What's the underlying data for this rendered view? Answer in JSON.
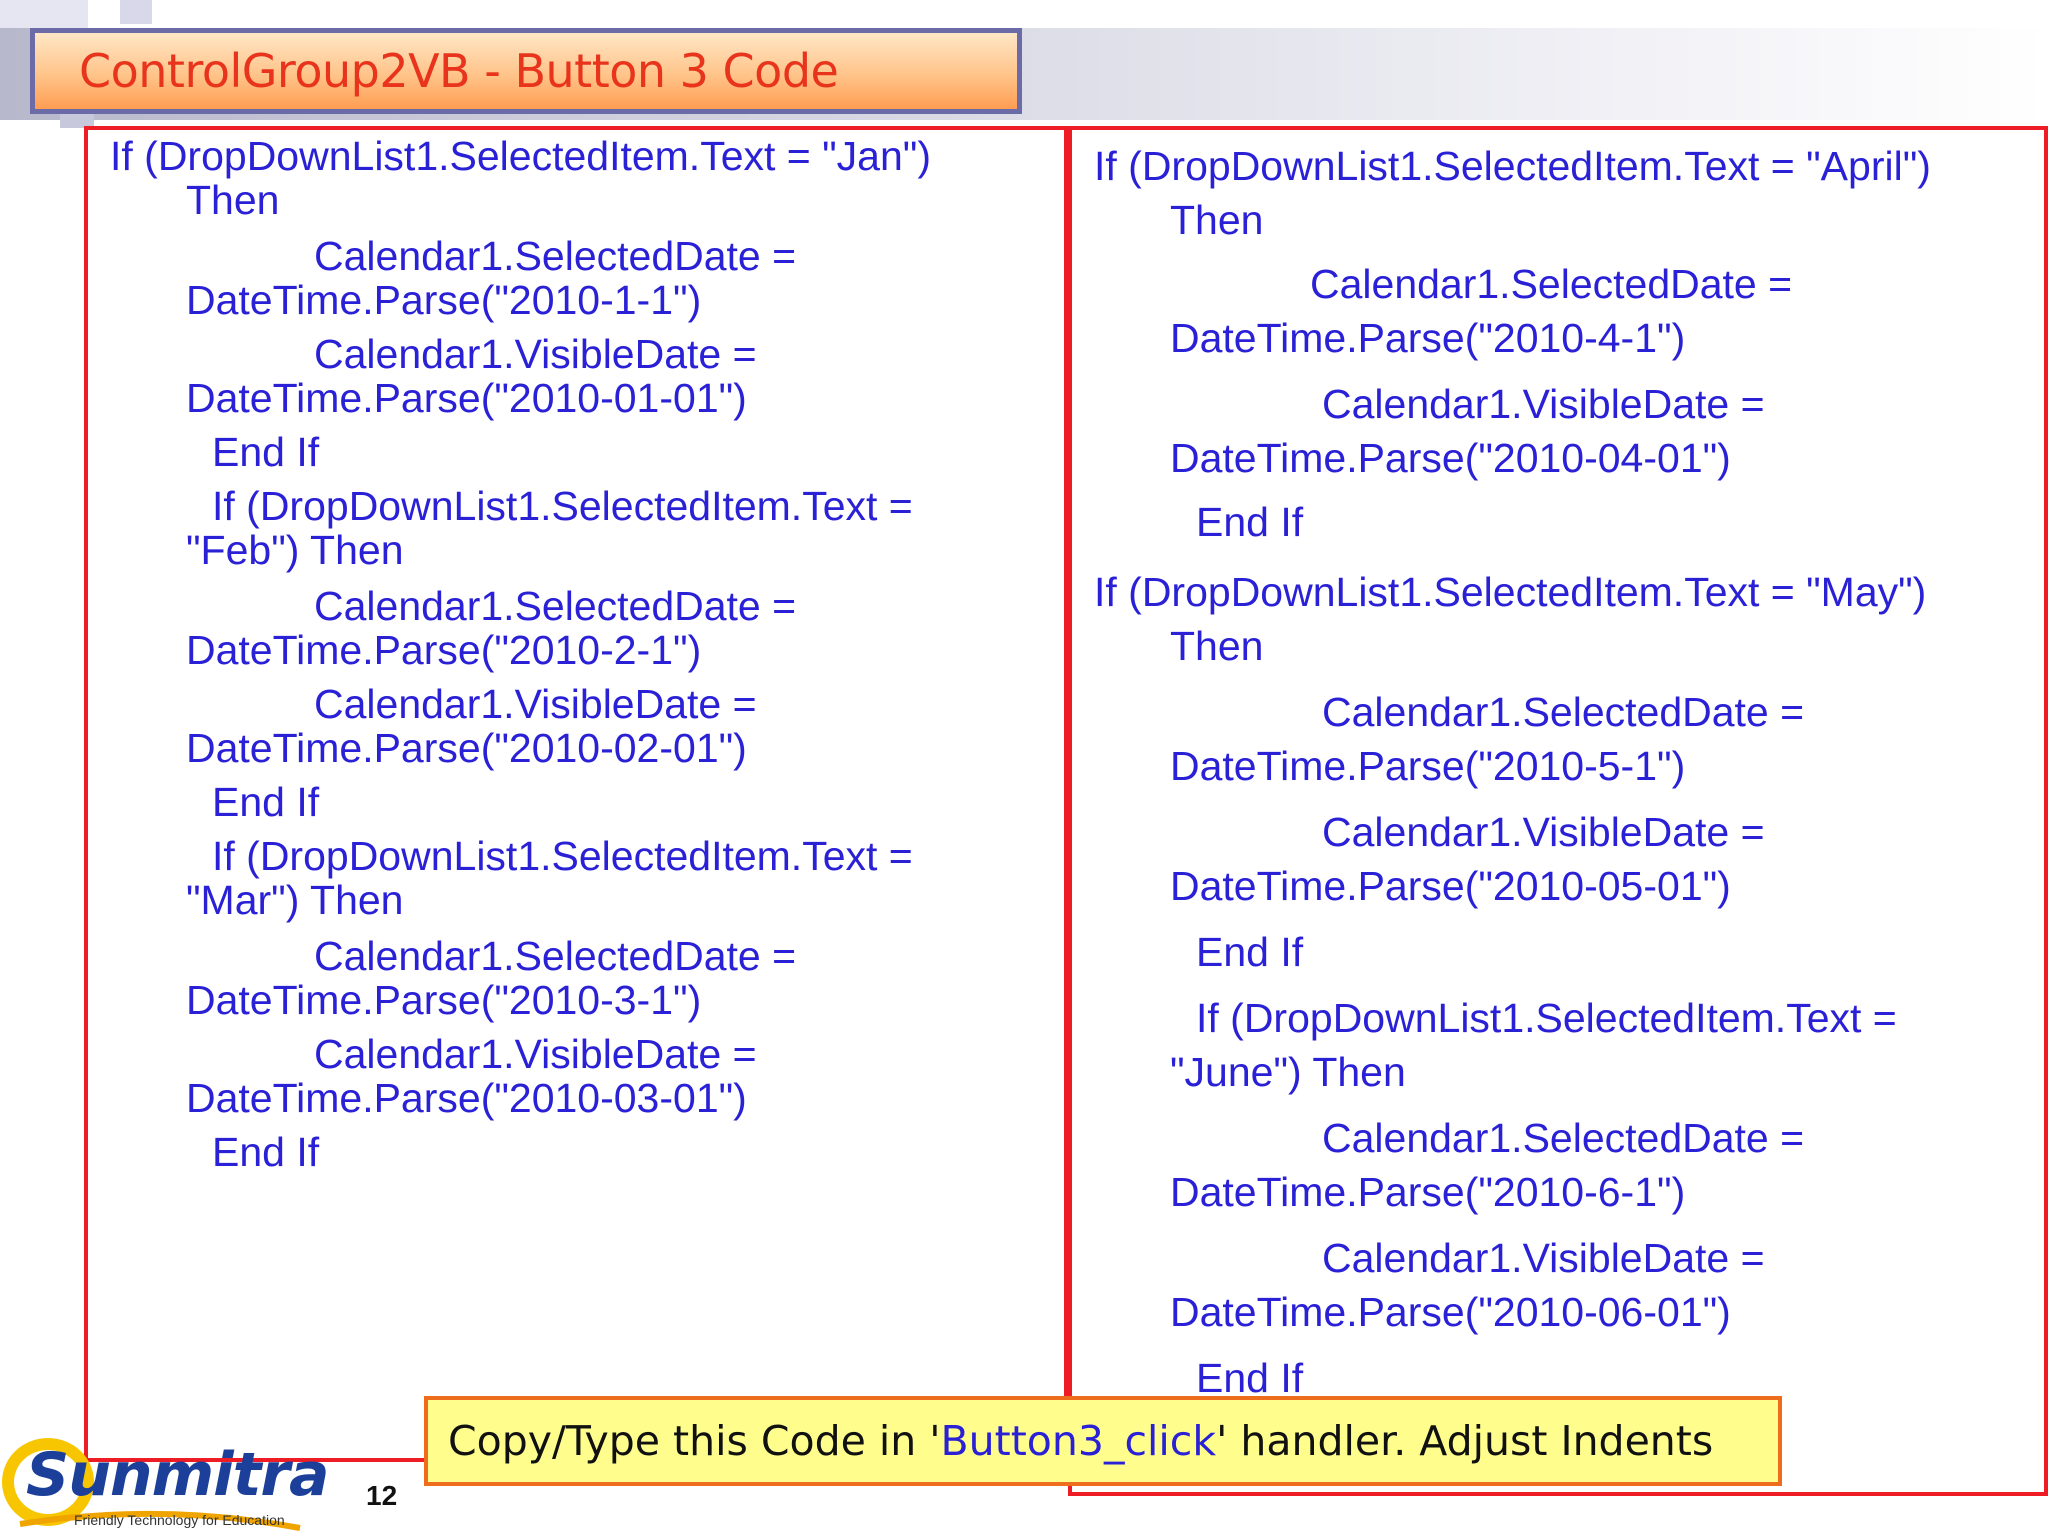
{
  "slide": {
    "title": "ControlGroup2VB - Button 3 Code",
    "page_number": "12"
  },
  "left_code": [
    "If (DropDownList1.SelectedItem.Text = \"Jan\")",
    "Then",
    "Calendar1.SelectedDate =",
    "DateTime.Parse(\"2010-1-1\")",
    "Calendar1.VisibleDate =",
    "DateTime.Parse(\"2010-01-01\")",
    "End If",
    "If (DropDownList1.SelectedItem.Text =",
    "\"Feb\") Then",
    "Calendar1.SelectedDate =",
    "DateTime.Parse(\"2010-2-1\")",
    "Calendar1.VisibleDate =",
    "DateTime.Parse(\"2010-02-01\")",
    "End If",
    "If (DropDownList1.SelectedItem.Text =",
    "\"Mar\") Then",
    "Calendar1.SelectedDate =",
    "DateTime.Parse(\"2010-3-1\")",
    "Calendar1.VisibleDate =",
    "DateTime.Parse(\"2010-03-01\")",
    "End If"
  ],
  "right_code": [
    "If (DropDownList1.SelectedItem.Text = \"April\")",
    "Then",
    "Calendar1.SelectedDate =",
    "DateTime.Parse(\"2010-4-1\")",
    "Calendar1.VisibleDate =",
    "DateTime.Parse(\"2010-04-01\")",
    "End If",
    "If (DropDownList1.SelectedItem.Text = \"May\")",
    "Then",
    "Calendar1.SelectedDate =",
    "DateTime.Parse(\"2010-5-1\")",
    "Calendar1.VisibleDate =",
    "DateTime.Parse(\"2010-05-01\")",
    "End If",
    "If (DropDownList1.SelectedItem.Text =",
    "\"June\") Then",
    "Calendar1.SelectedDate =",
    "DateTime.Parse(\"2010-6-1\")",
    "Calendar1.VisibleDate =",
    "DateTime.Parse(\"2010-06-01\")",
    "End If"
  ],
  "note": {
    "prefix": "Copy/Type this Code in '",
    "highlight": "Button3_click",
    "suffix": "' handler. Adjust Indents"
  },
  "logo": {
    "name": "Sunmitra",
    "tagline": "Friendly Technology for Education"
  },
  "colors": {
    "code_text": "#2a21d6",
    "box_border": "#ee1c24",
    "title_text": "#e8341c",
    "note_background": "#fffe8c"
  }
}
